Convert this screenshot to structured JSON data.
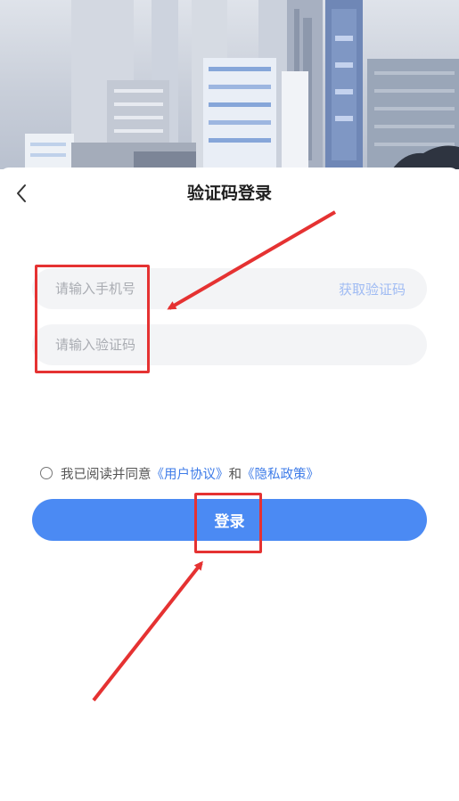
{
  "header": {
    "title": "验证码登录"
  },
  "form": {
    "phone_placeholder": "请输入手机号",
    "get_code_label": "获取验证码",
    "code_placeholder": "请输入验证码"
  },
  "agreement": {
    "prefix": "我已阅读并同意",
    "user_agreement": "《用户协议》",
    "conjunction": "和",
    "privacy_policy": "《隐私政策》",
    "checked": false
  },
  "login_label": "登录",
  "colors": {
    "primary": "#4b8af3",
    "link": "#3d7be8",
    "annotation": "#e53232"
  }
}
